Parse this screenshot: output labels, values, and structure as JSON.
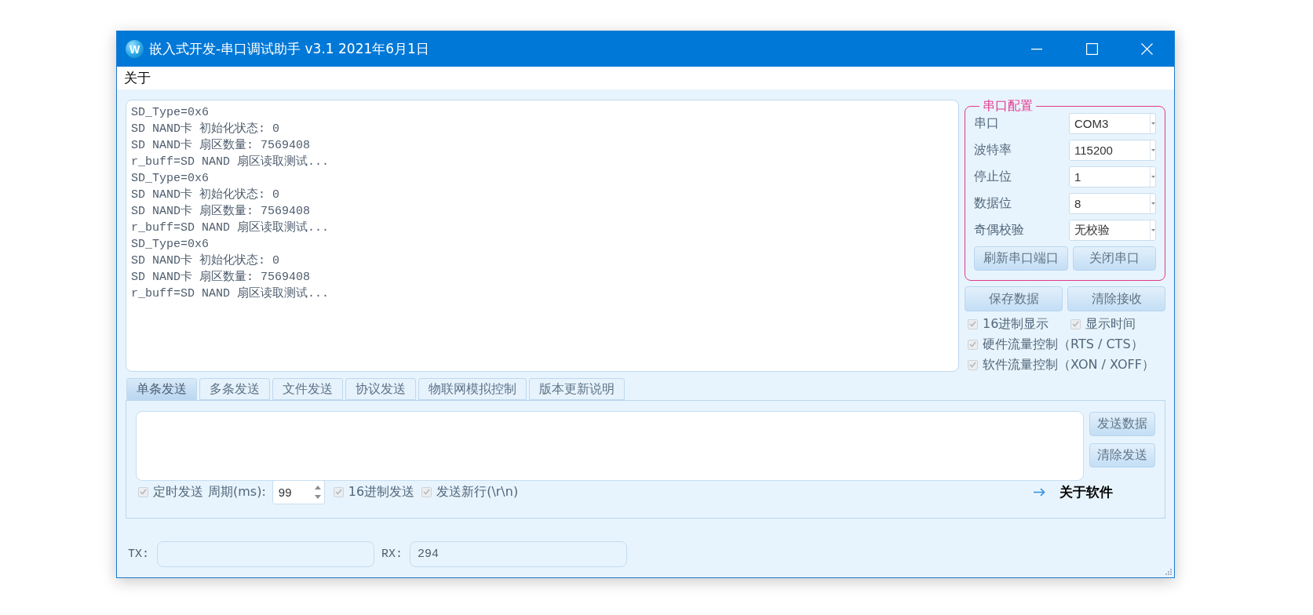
{
  "window": {
    "logo_letter": "W",
    "title": "嵌入式开发-串口调试助手 v3.1 2021年6月1日"
  },
  "menu": [
    {
      "label": "关于"
    }
  ],
  "receive_log": {
    "lines": [
      "SD_Type=0x6",
      "SD NAND卡 初始化状态: 0",
      "SD NAND卡 扇区数量: 7569408",
      "r_buff=SD NAND 扇区读取测试...",
      "SD_Type=0x6",
      "SD NAND卡 初始化状态: 0",
      "SD NAND卡 扇区数量: 7569408",
      "r_buff=SD NAND 扇区读取测试...",
      "SD_Type=0x6",
      "SD NAND卡 初始化状态: 0",
      "SD NAND卡 扇区数量: 7569408",
      "r_buff=SD NAND 扇区读取测试..."
    ]
  },
  "serial_config": {
    "title": "串口配置",
    "fields": [
      {
        "label": "串口",
        "value": "COM3"
      },
      {
        "label": "波特率",
        "value": "115200"
      },
      {
        "label": "停止位",
        "value": "1"
      },
      {
        "label": "数据位",
        "value": "8"
      },
      {
        "label": "奇偶校验",
        "value": "无校验"
      }
    ],
    "buttons": [
      "刷新串口端口",
      "关闭串口"
    ]
  },
  "receive_buttons": [
    "保存数据",
    "清除接收"
  ],
  "receive_options": [
    [
      {
        "label": "16进制显示",
        "checked": true
      },
      {
        "label": "显示时间",
        "checked": true
      }
    ],
    [
      {
        "label": "硬件流量控制（RTS / CTS）",
        "checked": true
      }
    ],
    [
      {
        "label": "软件流量控制（XON / XOFF）",
        "checked": true
      }
    ]
  ],
  "tabs": [
    {
      "label": "单条发送",
      "selected": true
    },
    {
      "label": "多条发送",
      "selected": false
    },
    {
      "label": "文件发送",
      "selected": false
    },
    {
      "label": "协议发送",
      "selected": false
    },
    {
      "label": "物联网模拟控制",
      "selected": false
    },
    {
      "label": "版本更新说明",
      "selected": false
    }
  ],
  "send": {
    "buttons": [
      "发送数据",
      "清除发送"
    ],
    "timed_send": {
      "label": "定时发送",
      "checked": true
    },
    "period_label": "周期(ms):",
    "period_value": "99",
    "options": [
      {
        "label": "16进制发送",
        "checked": true
      },
      {
        "label": "发送新行(\\r\\n)",
        "checked": true
      }
    ],
    "about_link": "关于软件"
  },
  "counters": {
    "tx_label": "TX:",
    "rx_label": "RX:",
    "rx_value": "294"
  }
}
